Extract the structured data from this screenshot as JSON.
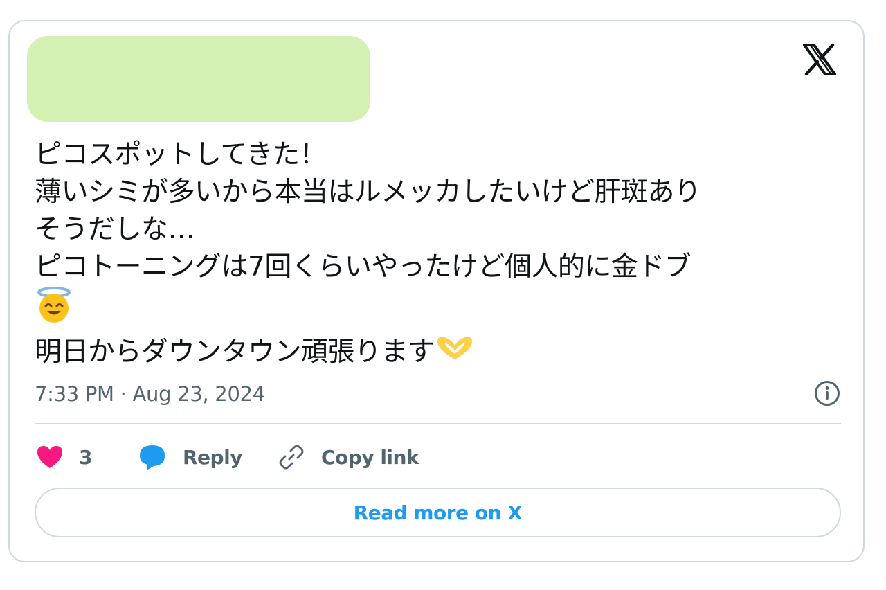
{
  "tweet": {
    "lines": [
      "ピコスポットしてきた！",
      "薄いシミが多いから本当はルメッカしたいけど肝斑あり",
      "そうだしな…",
      "ピコトーニングは7回くらいやったけど個人的に金ドブ",
      "明日からダウンタウン頑張ります"
    ],
    "emojis": [
      "smiling-face-with-halo",
      "heart-hands"
    ]
  },
  "timestamp": "7:33 PM · Aug 23, 2024",
  "actions": {
    "like_count": "3",
    "reply_label": "Reply",
    "copy_link_label": "Copy link"
  },
  "read_more_label": "Read more on X",
  "colors": {
    "like": "#f91880",
    "reply": "#1d9bf0",
    "muted": "#536471",
    "border": "#cfd9de",
    "link": "#1d9bf0",
    "redacted_author": "#d4f0b2"
  }
}
